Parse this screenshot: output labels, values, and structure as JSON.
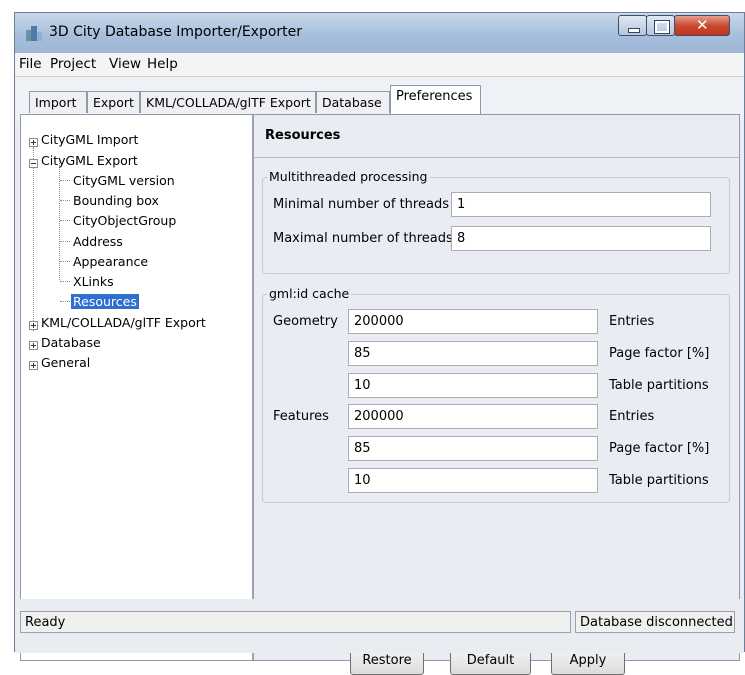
{
  "window": {
    "title": "3D City Database Importer/Exporter"
  },
  "menu": [
    "File",
    "Project",
    "View",
    "Help"
  ],
  "tabs": [
    "Import",
    "Export",
    "KML/COLLADA/glTF Export",
    "Database",
    "Preferences"
  ],
  "tree": {
    "items": [
      {
        "label": "CityGML Import"
      },
      {
        "label": "CityGML Export"
      },
      {
        "label": "CityGML version"
      },
      {
        "label": "Bounding box"
      },
      {
        "label": "CityObjectGroup"
      },
      {
        "label": "Address"
      },
      {
        "label": "Appearance"
      },
      {
        "label": "XLinks"
      },
      {
        "label": "Resources"
      },
      {
        "label": "KML/COLLADA/glTF Export"
      },
      {
        "label": "Database"
      },
      {
        "label": "General"
      }
    ]
  },
  "panel": {
    "title": "Resources",
    "threads": {
      "title": "Multithreaded processing",
      "min_label": "Minimal number of threads",
      "min_value": "1",
      "max_label": "Maximal number of threads",
      "max_value": "8"
    },
    "cache": {
      "title": "gml:id cache",
      "geometry_label": "Geometry",
      "features_label": "Features",
      "geometry": {
        "entries": "200000",
        "page_factor": "85",
        "table_partitions": "10"
      },
      "features": {
        "entries": "200000",
        "page_factor": "85",
        "table_partitions": "10"
      },
      "unit_entries": "Entries",
      "unit_page_factor": "Page factor [%]",
      "unit_partitions": "Table partitions"
    },
    "buttons": {
      "restore": "Restore",
      "default": "Default",
      "apply": "Apply"
    }
  },
  "status": {
    "left": "Ready",
    "right": "Database disconnected"
  }
}
